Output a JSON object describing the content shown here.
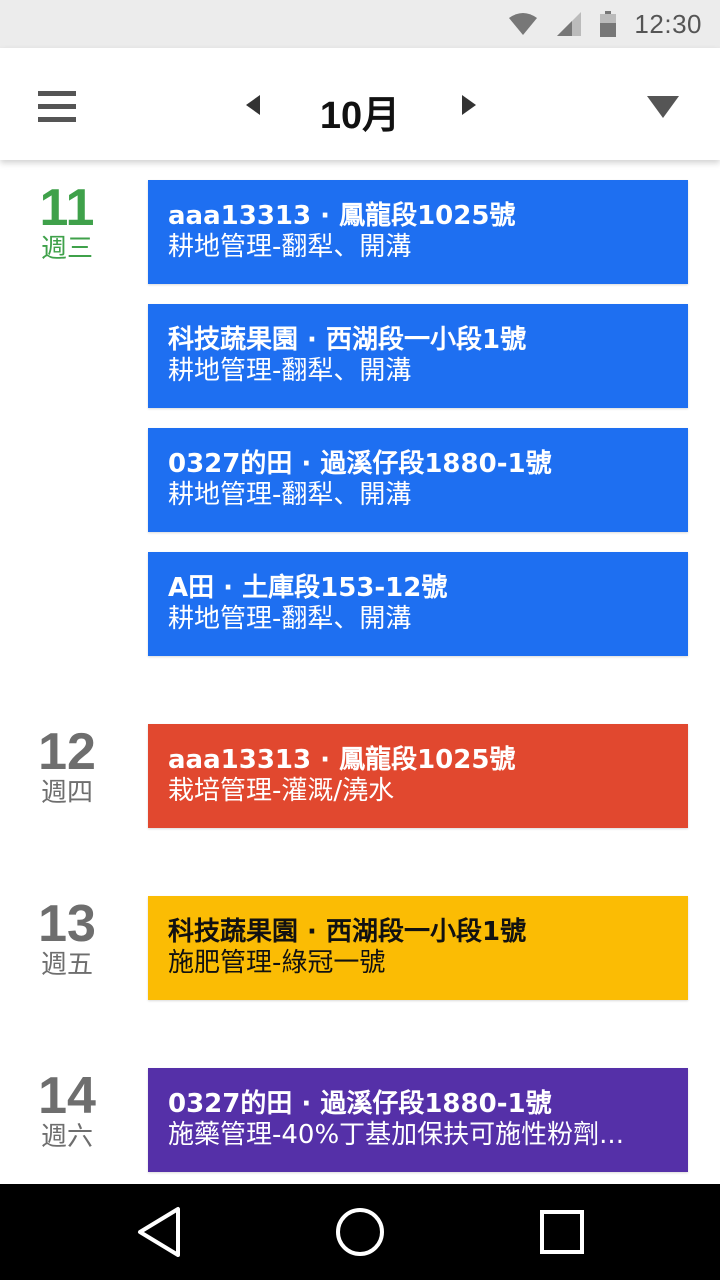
{
  "status_bar": {
    "time": "12:30",
    "icons": [
      "wifi-icon",
      "cell-signal-icon",
      "battery-icon"
    ]
  },
  "app_bar": {
    "month": "10月",
    "icons": [
      "menu-icon",
      "prev-month-icon",
      "next-month-icon",
      "dropdown-icon"
    ]
  },
  "days": [
    {
      "num": "11",
      "weekday": "週三",
      "today": true,
      "events": [
        {
          "title": "aaa13313 · 鳳龍段1025號",
          "desc": "耕地管理-翻犁、開溝",
          "color": "#1e6ff1"
        },
        {
          "title": "科技蔬果園 · 西湖段一小段1號",
          "desc": "耕地管理-翻犁、開溝",
          "color": "#1e6ff1"
        },
        {
          "title": "0327的田 · 過溪仔段1880-1號",
          "desc": "耕地管理-翻犁、開溝",
          "color": "#1e6ff1"
        },
        {
          "title": "A田 · 土庫段153-12號",
          "desc": "耕地管理-翻犁、開溝",
          "color": "#1e6ff1"
        }
      ]
    },
    {
      "num": "12",
      "weekday": "週四",
      "today": false,
      "events": [
        {
          "title": "aaa13313 · 鳳龍段1025號",
          "desc": "栽培管理-灌溉/澆水",
          "color": "#e1482f"
        }
      ]
    },
    {
      "num": "13",
      "weekday": "週五",
      "today": false,
      "events": [
        {
          "title": "科技蔬果園 · 西湖段一小段1號",
          "desc": "施肥管理-綠冠一號",
          "color": "#fbbc04"
        }
      ]
    },
    {
      "num": "14",
      "weekday": "週六",
      "today": false,
      "events": [
        {
          "title": "0327的田 · 過溪仔段1880-1號",
          "desc": "施藥管理-40%丁基加保扶可施性粉劑...",
          "color": "#5530a8"
        }
      ]
    }
  ],
  "nav_bar": {
    "icons": [
      "back-icon",
      "home-icon",
      "recents-icon"
    ]
  },
  "colors": {
    "accent_today": "#3fa14a",
    "status_bar_bg": "#ececec",
    "nav_bar_bg": "#000000"
  }
}
